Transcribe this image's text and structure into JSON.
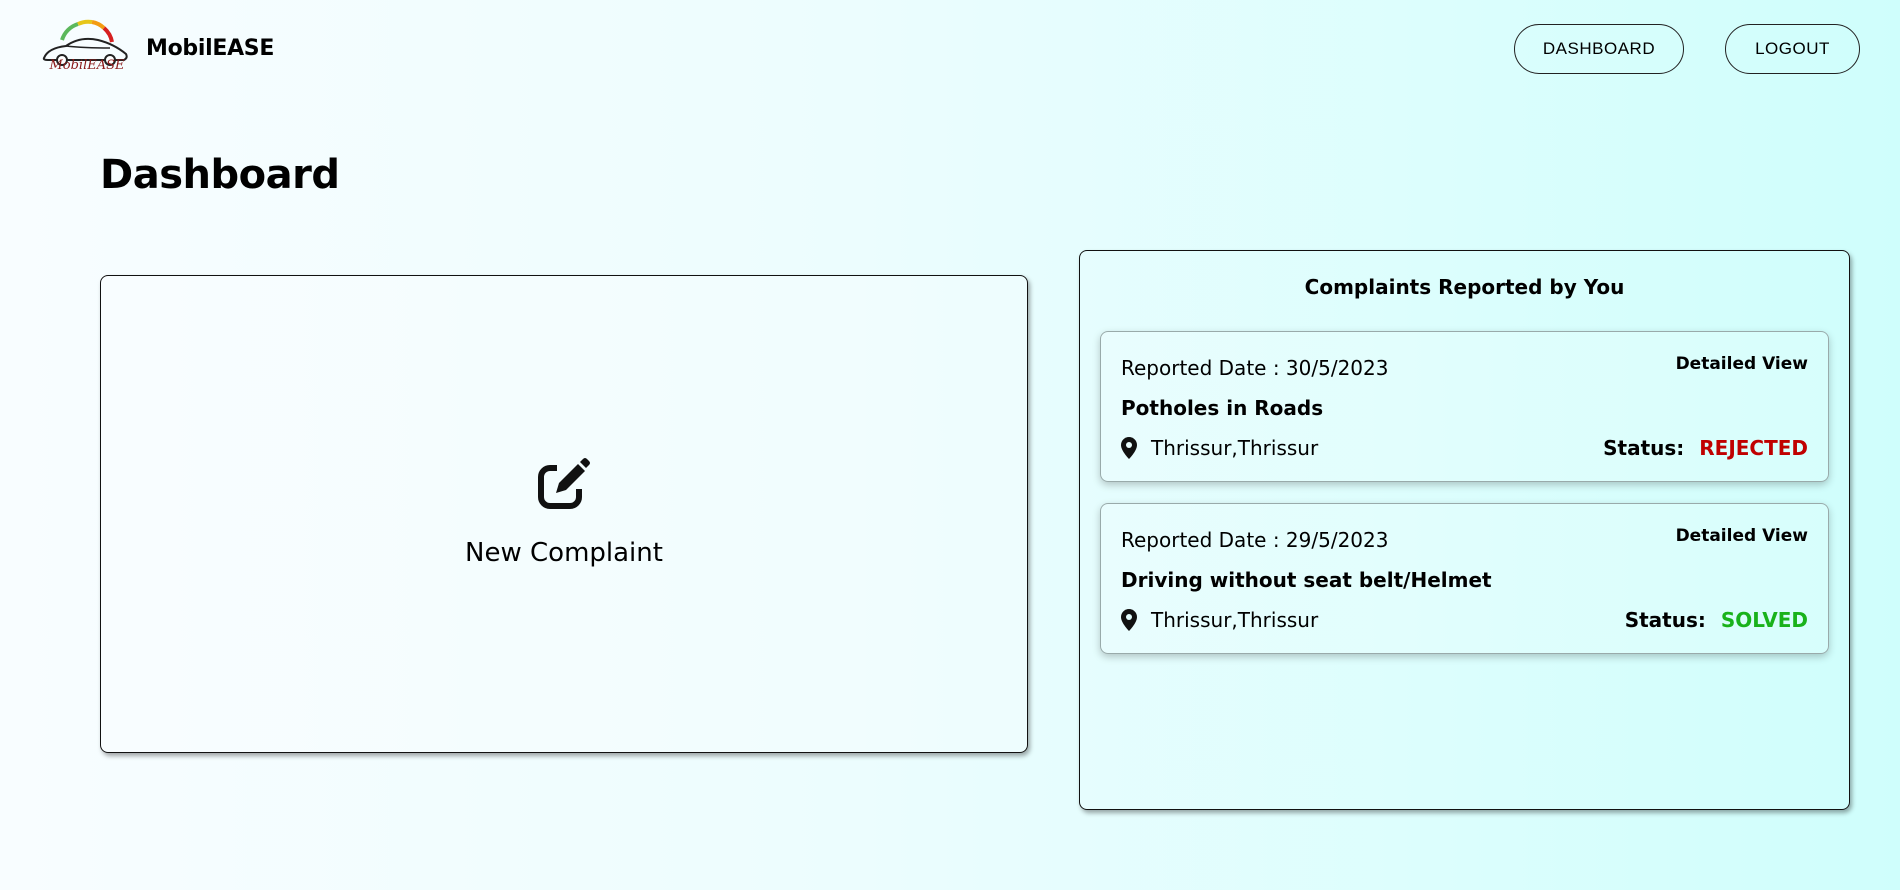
{
  "header": {
    "logo_text": "MobilEASE",
    "brand_name": "MobilEASE",
    "nav": {
      "dashboard_label": "DASHBOARD",
      "logout_label": "LOGOUT"
    }
  },
  "page": {
    "title": "Dashboard"
  },
  "new_complaint": {
    "label": "New Complaint",
    "icon": "edit-icon"
  },
  "complaints_panel": {
    "title": "Complaints Reported by You",
    "items": [
      {
        "reported_date": "Reported Date : 30/5/2023",
        "detail_label": "Detailed View",
        "title": "Potholes in Roads",
        "location": "Thrissur,Thrissur",
        "status_label": "Status:",
        "status_value": "REJECTED",
        "status_color": "#c00000"
      },
      {
        "reported_date": "Reported Date : 29/5/2023",
        "detail_label": "Detailed View",
        "title": "Driving without seat belt/Helmet",
        "location": "Thrissur,Thrissur",
        "status_label": "Status:",
        "status_value": "SOLVED",
        "status_color": "#19b21b"
      }
    ]
  },
  "colors": {
    "rejected": "#c00000",
    "solved": "#19b21b"
  }
}
